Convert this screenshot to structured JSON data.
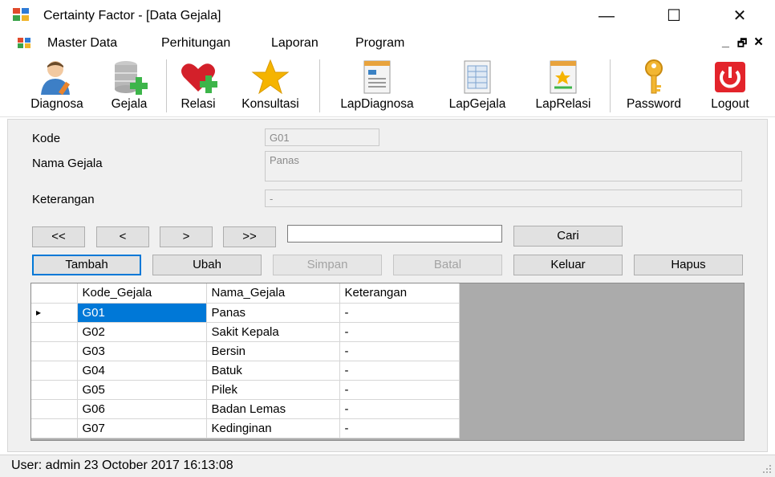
{
  "window": {
    "title": "Certainty Factor - [Data Gejala]",
    "controls": {
      "minimize": "—",
      "maximize": "☐",
      "close": "✕"
    },
    "mdi_controls": {
      "minimize": "_",
      "restore": "🗗",
      "close": "×"
    }
  },
  "menu": {
    "items": [
      "Master Data",
      "Perhitungan",
      "Laporan",
      "Program"
    ]
  },
  "toolbar": {
    "buttons": [
      {
        "label": "Diagnosa",
        "icon": "user-edit-icon"
      },
      {
        "label": "Gejala",
        "icon": "database-add-icon"
      },
      {
        "label": "Relasi",
        "icon": "heart-add-icon"
      },
      {
        "label": "Konsultasi",
        "icon": "star-icon"
      },
      {
        "label": "LapDiagnosa",
        "icon": "report-icon"
      },
      {
        "label": "LapGejala",
        "icon": "table-report-icon"
      },
      {
        "label": "LapRelasi",
        "icon": "chart-report-icon"
      },
      {
        "label": "Password",
        "icon": "key-icon"
      },
      {
        "label": "Logout",
        "icon": "power-icon"
      }
    ]
  },
  "form": {
    "kode_label": "Kode",
    "kode_value": "G01",
    "nama_label": "Nama Gejala",
    "nama_value": "Panas",
    "keterangan_label": "Keterangan",
    "keterangan_value": "-"
  },
  "nav": {
    "first": "<<",
    "prev": "<",
    "next": ">",
    "last": ">>",
    "search_value": "",
    "search_button": "Cari"
  },
  "actions": {
    "tambah": "Tambah",
    "ubah": "Ubah",
    "simpan": "Simpan",
    "batal": "Batal",
    "keluar": "Keluar",
    "hapus": "Hapus"
  },
  "grid": {
    "columns": [
      "Kode_Gejala",
      "Nama_Gejala",
      "Keterangan"
    ],
    "row_marker": "▸",
    "rows": [
      [
        "G01",
        "Panas",
        "-"
      ],
      [
        "G02",
        "Sakit Kepala",
        "-"
      ],
      [
        "G03",
        "Bersin",
        "-"
      ],
      [
        "G04",
        "Batuk",
        "-"
      ],
      [
        "G05",
        "Pilek",
        "-"
      ],
      [
        "G06",
        "Badan Lemas",
        "-"
      ],
      [
        "G07",
        "Kedinginan",
        "-"
      ]
    ]
  },
  "status": {
    "text": "User: admin  23 October 2017 16:13:08"
  },
  "colors": {
    "selection": "#0078d7",
    "heart": "#d3202a",
    "star": "#f5b400",
    "power": "#e3242b"
  }
}
